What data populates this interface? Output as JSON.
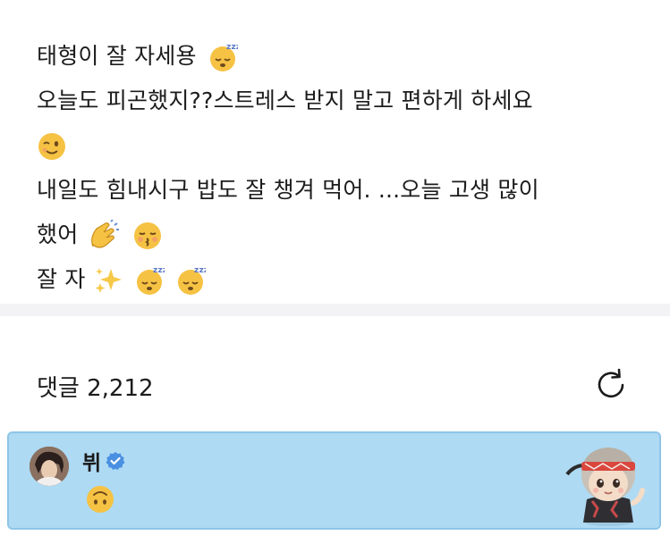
{
  "post": {
    "lines": [
      {
        "text": "태형이 잘 자세용",
        "emojis": [
          "sleeping-face"
        ]
      },
      {
        "text": "오늘도 피곤했지??스트레스 받지 말고 편하게 하세요",
        "emojis": []
      },
      {
        "text": "",
        "emojis": [
          "winking-face"
        ]
      },
      {
        "text": "내일도 힘내시구 밥도 잘 챙겨 먹어. ...오늘 고생 많이",
        "emojis": []
      },
      {
        "text": "했어",
        "emojis": [
          "clapping-hands",
          "kissing-face-closed-eyes"
        ]
      },
      {
        "text": "잘 자",
        "emojis": [
          "sparkles",
          "sleeping-face",
          "sleeping-face"
        ]
      }
    ]
  },
  "comments": {
    "label": "댓글",
    "count": "2,212",
    "title": "댓글 2,212",
    "refresh_icon": "refresh-icon"
  },
  "comment": {
    "author": "뷔",
    "verified_icon": "verified-badge-icon",
    "body_emoji": "upside-down-face",
    "avatar_icon": "profile-photo",
    "sticker_icon": "chibi-character-sticker"
  },
  "colors": {
    "highlight_bg": "#aedaf3",
    "highlight_border": "#8ec5e8",
    "divider": "#f3f3f6",
    "verified": "#4a90e2"
  }
}
